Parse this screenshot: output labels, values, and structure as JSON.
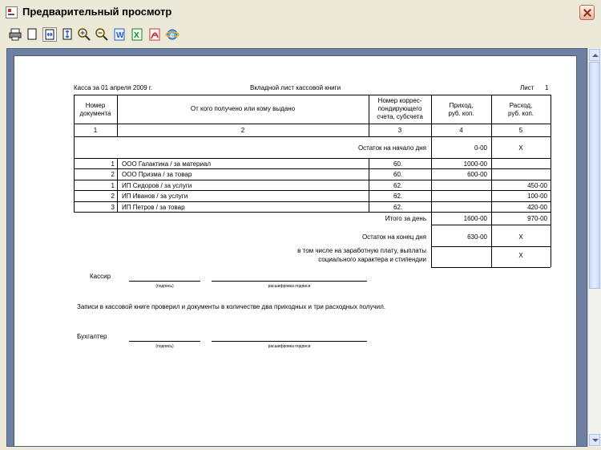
{
  "window": {
    "title": "Предварительный просмотр",
    "close_icon": "close-icon"
  },
  "toolbar": {
    "buttons": [
      {
        "icon": "printer-icon"
      },
      {
        "icon": "page-icon"
      },
      {
        "icon": "fit-width-icon"
      },
      {
        "icon": "fit-page-icon"
      },
      {
        "icon": "zoom-in-icon"
      },
      {
        "icon": "zoom-out-icon"
      },
      {
        "icon": "word-export-icon"
      },
      {
        "icon": "excel-export-icon"
      },
      {
        "icon": "pdf-export-icon"
      },
      {
        "icon": "internet-explorer-icon"
      }
    ]
  },
  "document": {
    "header_left": "Касса за 01 апреля 2009 г.",
    "header_center": "Вкладной лист кассовой книги",
    "sheet_label": "Лист",
    "sheet_number": "1",
    "columns": [
      {
        "line1": "Номер",
        "line2": "документа"
      },
      {
        "line1": "От кого получено или кому выдано",
        "line2": ""
      },
      {
        "line1": "Номер коррес-",
        "line2": "пондирующего",
        "line3": "счета, субсчета"
      },
      {
        "line1": "Приход,",
        "line2": "руб. коп."
      },
      {
        "line1": "Расход,",
        "line2": "руб. коп."
      }
    ],
    "column_numbers": [
      "1",
      "2",
      "3",
      "4",
      "5"
    ],
    "opening_balance": {
      "label": "Остаток на начало дня",
      "income": "0-00",
      "expense": "X"
    },
    "rows": [
      {
        "number": "1",
        "name": "ООО Галактика / за материал",
        "account": "60.",
        "income": "1000-00",
        "expense": ""
      },
      {
        "number": "2",
        "name": "ООО Призма / за товар",
        "account": "60.",
        "income": "600-00",
        "expense": ""
      },
      {
        "number": "1",
        "name": "ИП Сидоров / за услуги",
        "account": "62.",
        "income": "",
        "expense": "450-00"
      },
      {
        "number": "2",
        "name": "ИП Иванов / за услуги",
        "account": "62.",
        "income": "",
        "expense": "100-00"
      },
      {
        "number": "3",
        "name": "ИП Петров / за товар",
        "account": "62.",
        "income": "",
        "expense": "420-00"
      }
    ],
    "day_total": {
      "label": "Итого за день",
      "income": "1600-00",
      "expense": "970-00"
    },
    "closing_balance": {
      "label": "Остаток на конец дня",
      "income": "630-00",
      "expense": "X"
    },
    "including": {
      "line1": "в том числе на заработную плату, выплаты",
      "line2": "социального характера и стипендии",
      "income": "",
      "expense": "X"
    },
    "cashier_label": "Кассир",
    "signature_caption": "(подпись)",
    "signature_decoding_caption": "расшифровка подписи",
    "check_text": "Записи в кассовой книге проверил и документы в количестве два приходных и три расходных получил.",
    "accountant_label": "Бухгалтер"
  }
}
